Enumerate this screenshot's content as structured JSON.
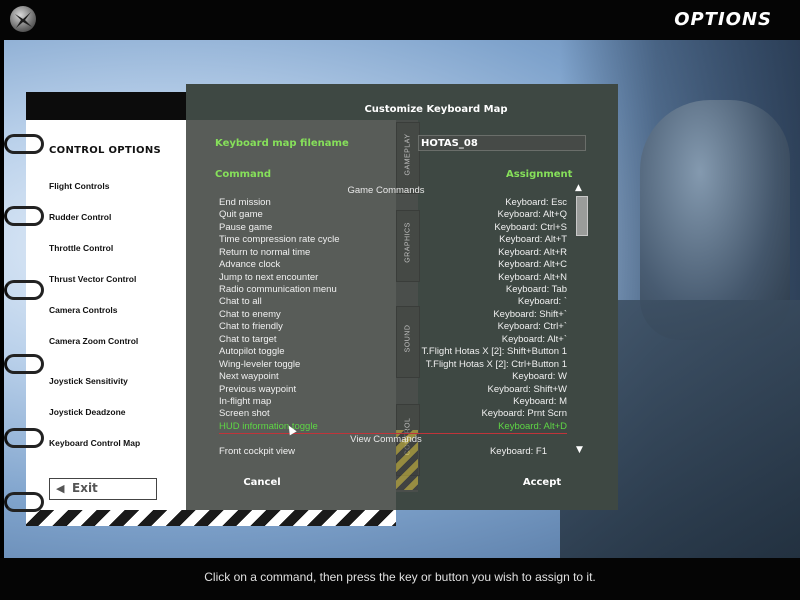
{
  "header": {
    "title": "OPTIONS"
  },
  "sidebar": {
    "title": "CONTROL OPTIONS",
    "items": [
      {
        "label": "Flight Controls"
      },
      {
        "label": "Rudder Control"
      },
      {
        "label": "Throttle Control"
      },
      {
        "label": "Thrust Vector Control"
      },
      {
        "label": "Camera Controls"
      },
      {
        "label": "Camera Zoom Control"
      },
      {
        "label": "Joystick Sensitivity"
      },
      {
        "label": "Joystick Deadzone"
      },
      {
        "label": "Keyboard Control Map"
      }
    ],
    "exit_label": "Exit"
  },
  "dialog": {
    "title": "Customize Keyboard Map",
    "filename_label": "Keyboard map filename",
    "filename_value": "HOTAS_08",
    "command_header": "Command",
    "assignment_header": "Assignment",
    "tabs": [
      "GAMEPLAY",
      "GRAPHICS",
      "SOUND",
      "CONTROL"
    ],
    "sections": {
      "game": "Game Commands",
      "view": "View Commands"
    },
    "rows": [
      {
        "cmd": "End mission",
        "asg": "Keyboard: Esc"
      },
      {
        "cmd": "Quit game",
        "asg": "Keyboard: Alt+Q"
      },
      {
        "cmd": "Pause game",
        "asg": "Keyboard: Ctrl+S"
      },
      {
        "cmd": "Time compression rate cycle",
        "asg": "Keyboard: Alt+T"
      },
      {
        "cmd": "Return to normal time",
        "asg": "Keyboard: Alt+R"
      },
      {
        "cmd": "Advance clock",
        "asg": "Keyboard: Alt+C"
      },
      {
        "cmd": "Jump to next encounter",
        "asg": "Keyboard: Alt+N"
      },
      {
        "cmd": "Radio communication menu",
        "asg": "Keyboard: Tab"
      },
      {
        "cmd": "Chat to all",
        "asg": "Keyboard: `"
      },
      {
        "cmd": "Chat to enemy",
        "asg": "Keyboard: Shift+`"
      },
      {
        "cmd": "Chat to friendly",
        "asg": "Keyboard: Ctrl+`"
      },
      {
        "cmd": "Chat to target",
        "asg": "Keyboard: Alt+`"
      },
      {
        "cmd": "Autopilot toggle",
        "asg": "T.Flight Hotas X [2]: Shift+Button 1"
      },
      {
        "cmd": "Wing-leveler toggle",
        "asg": "T.Flight Hotas X [2]: Ctrl+Button 1"
      },
      {
        "cmd": "Next waypoint",
        "asg": "Keyboard: W"
      },
      {
        "cmd": "Previous waypoint",
        "asg": "Keyboard: Shift+W"
      },
      {
        "cmd": "In-flight map",
        "asg": "Keyboard: M"
      },
      {
        "cmd": "Screen shot",
        "asg": "Keyboard: Prnt Scrn"
      },
      {
        "cmd": "HUD information toggle",
        "asg": "Keyboard: Alt+D"
      }
    ],
    "view_row": {
      "cmd": "Front cockpit view",
      "asg": "Keyboard: F1"
    },
    "cancel_label": "Cancel",
    "accept_label": "Accept",
    "selected_color": "#5ed645"
  },
  "footer": {
    "hint": "Click on a command, then press the key or button you wish to assign to it."
  }
}
